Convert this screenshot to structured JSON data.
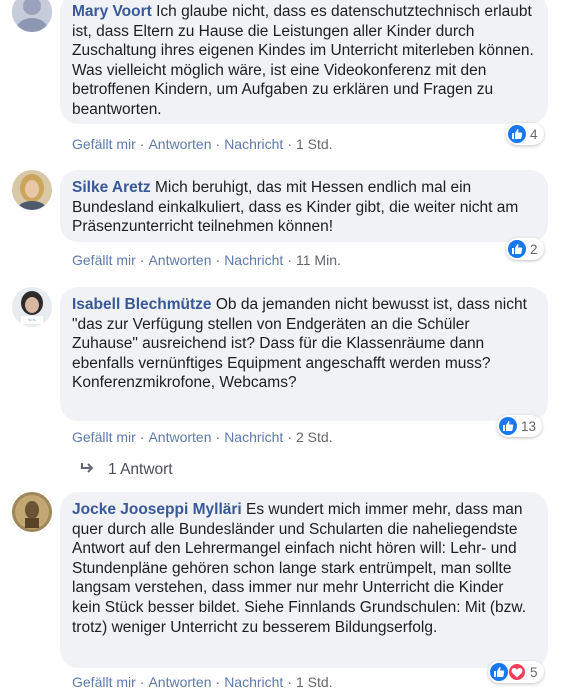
{
  "comments": [
    {
      "author": "Mary Voort",
      "text": "Ich glaube nicht, dass es datenschutztechnisch erlaubt ist, dass Eltern zu Hause die Leistungen aller Kinder durch Zuschaltung ihres eigenen Kindes im Unterricht miterleben können. Was vielleicht möglich wäre, ist eine Videokonferenz mit den betroffenen Kindern, um Aufgaben zu erklären und Fragen zu beantworten.",
      "actions": [
        "Gefällt mir",
        "Antworten",
        "Nachricht"
      ],
      "time": "1 Std.",
      "reactions": "4"
    },
    {
      "author": "Silke Aretz",
      "text": "Mich beruhigt, das mit Hessen endlich mal ein Bundesland einkalkuliert, dass es Kinder gibt, die weiter nicht am Präsenzunterricht teilnehmen können!",
      "actions": [
        "Gefällt mir",
        "Antworten",
        "Nachricht"
      ],
      "time": "11 Min.",
      "reactions": "2"
    },
    {
      "author": "Isabell Blechmütze",
      "text": "Ob da jemanden nicht bewusst ist, dass nicht \"das zur Verfügung stellen von Endgeräten an die Schüler Zuhause\" ausreichend ist? Dass für die Klassenräume dann ebenfalls vernünftiges Equipment angeschafft werden muss? Konferenzmikrofone, Webcams?",
      "actions": [
        "Gefällt mir",
        "Antworten",
        "Nachricht"
      ],
      "time": "2 Std.",
      "reactions": "13",
      "replies": "1 Antwort"
    },
    {
      "author": "Jocke Jooseppi Mylläri",
      "text": "Es wundert mich immer mehr, dass man quer durch alle Bundesländer und Schularten die naheliegendste Antwort auf den Lehrermangel einfach nicht hören will: Lehr- und Stundenpläne gehören schon lange stark entrümpelt, man sollte langsam verstehen, dass immer nur mehr Unterricht die Kinder kein Stück besser bildet. Siehe Finnlands Grundschulen: Mit (bzw. trotz) weniger Unterricht zu besserem Bildungserfolg.",
      "actions": [
        "Gefällt mir",
        "Antworten",
        "Nachricht"
      ],
      "time": "1 Std.",
      "reactions": "5"
    }
  ],
  "colors": {
    "author": "#385898",
    "bubble": "#f0f2f5",
    "like": "#1877f2",
    "love": "#f33e58"
  }
}
